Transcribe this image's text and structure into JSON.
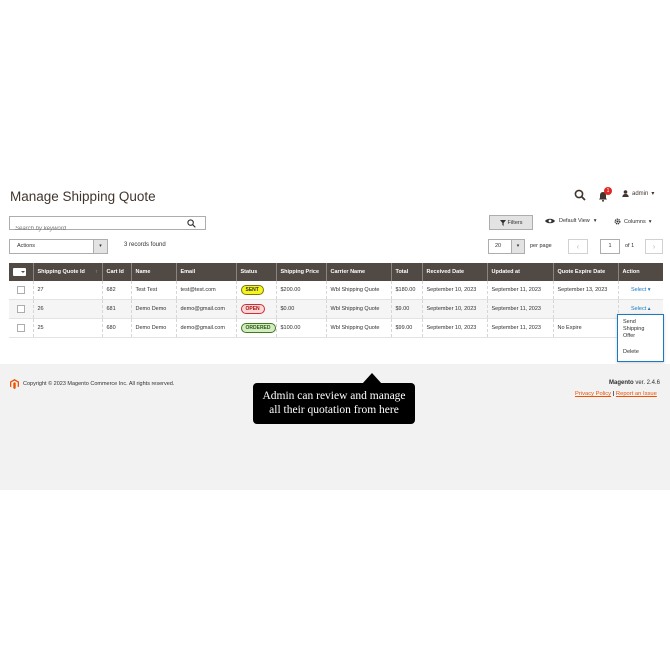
{
  "header": {
    "title": "Manage Shipping Quote",
    "notifications_count": "1",
    "user": "admin",
    "user_caret": "▾"
  },
  "toolbar": {
    "search_placeholder": "Search by keyword",
    "filters_label": "Filters",
    "view_label": "Default View",
    "columns_label": "Columns",
    "caret": "▾",
    "actions_label": "Actions",
    "records_text": "3 records found",
    "per_page_value": "20",
    "per_page_label": "per page",
    "page_value": "1",
    "page_of": "of 1",
    "prev": "‹",
    "next": "›"
  },
  "grid": {
    "columns": [
      "Shipping Quote Id",
      "Cart Id",
      "Name",
      "Email",
      "Status",
      "Shipping Price",
      "Carrier Name",
      "Total",
      "Received Date",
      "Updated at",
      "Quote Expire Date",
      "Action"
    ],
    "sort_indicator": "↑",
    "rows": [
      {
        "id": "27",
        "cart": "682",
        "name": "Test Test",
        "email": "test@test.com",
        "status": "SENT",
        "price": "$200.00",
        "carrier": "Wbl Shipping Quote",
        "total": "$180.00",
        "received": "September 10, 2023",
        "updated": "September 11, 2023",
        "expire": "September 13, 2023",
        "action": "Select ▾"
      },
      {
        "id": "26",
        "cart": "681",
        "name": "Demo Demo",
        "email": "demo@gmail.com",
        "status": "OPEN",
        "price": "$0.00",
        "carrier": "Wbl Shipping Quote",
        "total": "$9.00",
        "received": "September 10, 2023",
        "updated": "September 11, 2023",
        "expire": "",
        "action": "Select ▴"
      },
      {
        "id": "25",
        "cart": "680",
        "name": "Demo Demo",
        "email": "demo@gmail.com",
        "status": "ORDERED",
        "price": "$100.00",
        "carrier": "Wbl Shipping Quote",
        "total": "$99.00",
        "received": "September 10, 2023",
        "updated": "September 11, 2023",
        "expire": "No Expire",
        "action": ""
      }
    ],
    "action_menu": [
      "Send",
      "Shipping",
      "Offer",
      "Delete"
    ]
  },
  "footer": {
    "copyright": "Copyright © 2023 Magento Commerce Inc. All rights reserved.",
    "brand": "Magento",
    "version": " ver. 2.4.6",
    "privacy": "Privacy Policy",
    "separator": " | ",
    "report": "Report an Issue"
  },
  "callout": {
    "line1": "Admin can review and manage",
    "line2": "all their quotation from here"
  },
  "colors": {
    "grid_header_bg": "#514943",
    "link": "#1979c3",
    "footer_link": "#eb5202",
    "status_sent": "#f5f51d",
    "status_open": "#fcd6d6",
    "status_ordered": "#d4ecc1"
  }
}
